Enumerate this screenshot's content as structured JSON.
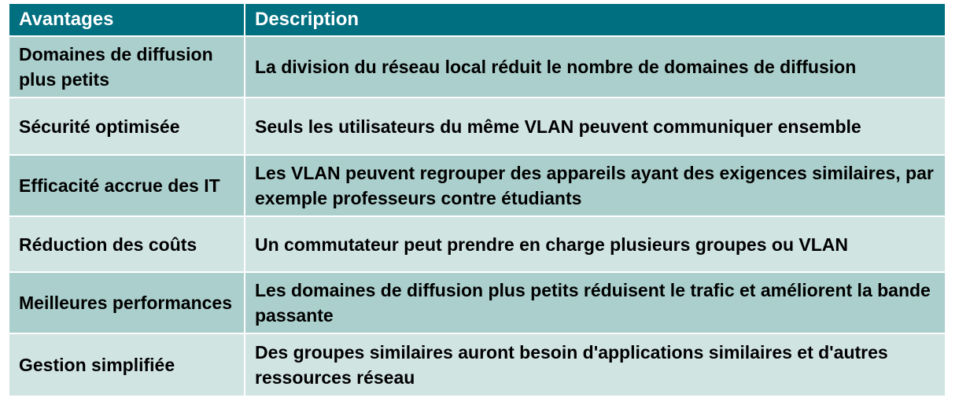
{
  "table": {
    "headers": [
      "Avantages",
      "Description"
    ],
    "rows": [
      {
        "advantage": "Domaines de diffusion plus petits",
        "description": "La division du réseau local réduit le nombre de domaines de diffusion"
      },
      {
        "advantage": "Sécurité optimisée",
        "description": "Seuls les utilisateurs du même VLAN peuvent communiquer ensemble"
      },
      {
        "advantage": "Efficacité accrue des IT",
        "description": "Les VLAN peuvent regrouper des appareils ayant des exigences similaires, par exemple professeurs contre étudiants"
      },
      {
        "advantage": "Réduction des coûts",
        "description": "Un commutateur peut prendre en charge plusieurs groupes ou VLAN"
      },
      {
        "advantage": "Meilleures performances",
        "description": "Les domaines de diffusion plus petits réduisent le trafic et améliorent la bande passante"
      },
      {
        "advantage": "Gestion simplifiée",
        "description": "Des groupes similaires auront besoin d'applications similaires et d'autres ressources réseau"
      }
    ]
  },
  "colors": {
    "header": "#006f80",
    "row_dark": "#aacfcc",
    "row_light": "#d0e4e2"
  }
}
